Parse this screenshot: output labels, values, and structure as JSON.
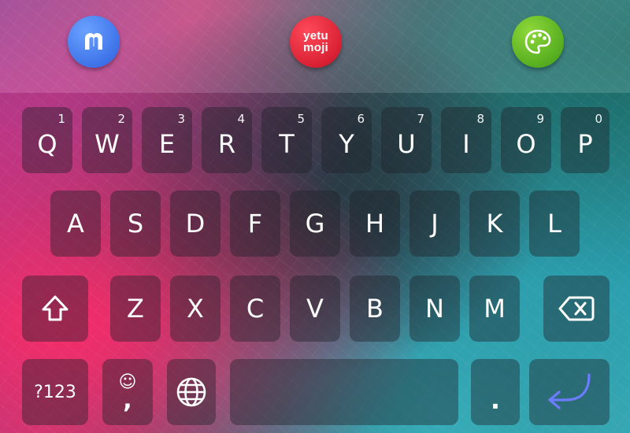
{
  "toolbar": {
    "apps": [
      {
        "name": "mastodon",
        "icon": "mastodon-icon"
      },
      {
        "name": "yetumoji",
        "text_line1": "yetu",
        "text_line2": "moji"
      },
      {
        "name": "themes",
        "icon": "palette-icon"
      }
    ]
  },
  "keyboard": {
    "row1": [
      {
        "label": "Q",
        "hint": "1"
      },
      {
        "label": "W",
        "hint": "2"
      },
      {
        "label": "E",
        "hint": "3"
      },
      {
        "label": "R",
        "hint": "4"
      },
      {
        "label": "T",
        "hint": "5"
      },
      {
        "label": "Y",
        "hint": "6"
      },
      {
        "label": "U",
        "hint": "7"
      },
      {
        "label": "I",
        "hint": "8"
      },
      {
        "label": "O",
        "hint": "9"
      },
      {
        "label": "P",
        "hint": "0"
      }
    ],
    "row2": [
      "A",
      "S",
      "D",
      "F",
      "G",
      "H",
      "J",
      "K",
      "L"
    ],
    "row3": [
      "Z",
      "X",
      "C",
      "V",
      "B",
      "N",
      "M"
    ],
    "row4": {
      "symbols_label": "?123",
      "emoji_comma": {
        "top": "☺",
        "bottom": ","
      },
      "period_label": "."
    }
  },
  "colors": {
    "key_bg": "rgba(30,34,40,0.42)",
    "enter_arrow": "#6d7cff",
    "mastodon": "#3a6df0",
    "yetumoji": "#e01a2e",
    "themes": "#5cb521"
  }
}
